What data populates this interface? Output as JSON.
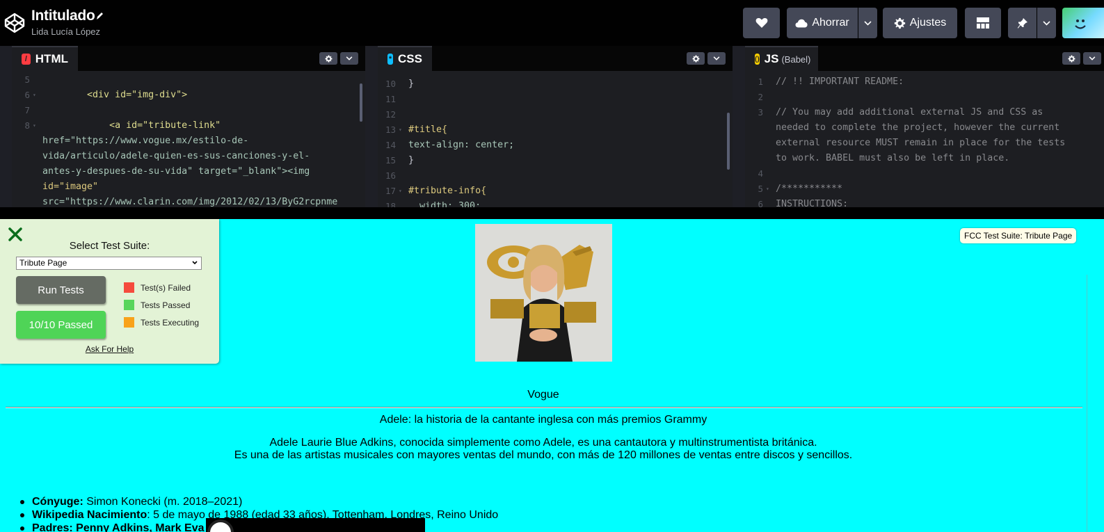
{
  "header": {
    "title": "Intitulado",
    "author": "Lida Lucía López",
    "save_label": "Ahorrar",
    "settings_label": "Ajustes"
  },
  "editors": {
    "html": {
      "label": "HTML",
      "lines": [
        {
          "n": "5",
          "text": ""
        },
        {
          "n": "6",
          "text": "        <div id=\"img-div\">"
        },
        {
          "n": "7",
          "text": ""
        },
        {
          "n": "8",
          "text": "            <a id=\"tribute-link\""
        },
        {
          "n": "",
          "text": "href=\"https://www.vogue.mx/estilo-de-"
        },
        {
          "n": "",
          "text": "vida/articulo/adele-quien-es-sus-canciones-y-el-"
        },
        {
          "n": "",
          "text": "antes-y-despues-de-su-vida\" target=\"_blank\"><img"
        },
        {
          "n": "",
          "text": "id=\"image\""
        },
        {
          "n": "",
          "text": "src=\"https://www.clarin.com/img/2012/02/13/ByG2rcpnme"
        }
      ]
    },
    "css": {
      "label": "CSS",
      "lines": [
        {
          "n": "10",
          "text": "}"
        },
        {
          "n": "11",
          "text": ""
        },
        {
          "n": "12",
          "text": ""
        },
        {
          "n": "13",
          "text": "#title{"
        },
        {
          "n": "14",
          "text": "text-align: center;"
        },
        {
          "n": "15",
          "text": "}"
        },
        {
          "n": "16",
          "text": ""
        },
        {
          "n": "17",
          "text": "#tribute-info{"
        },
        {
          "n": "18",
          "text": "  width: 300;"
        }
      ]
    },
    "js": {
      "label": "JS",
      "sublabel": "(Babel)",
      "lines": [
        {
          "n": "1",
          "text": "// !! IMPORTANT README:"
        },
        {
          "n": "2",
          "text": ""
        },
        {
          "n": "3",
          "text": "// You may add additional external JS and CSS as"
        },
        {
          "n": "",
          "text": "needed to complete the project, however the current"
        },
        {
          "n": "",
          "text": "external resource MUST remain in place for the tests"
        },
        {
          "n": "",
          "text": "to work. BABEL must also be left in place."
        },
        {
          "n": "4",
          "text": ""
        },
        {
          "n": "5",
          "text": "/***********"
        },
        {
          "n": "6",
          "text": "INSTRUCTIONS:"
        }
      ]
    }
  },
  "preview": {
    "source": "Vogue",
    "headline": "Adele: la historia de la cantante inglesa con más premios Grammy",
    "info_line1": "Adele Laurie Blue Adkins, conocida simplemente como Adele, es una cantautora y multinstrumentista británica.",
    "info_line2": "Es una de las artistas musicales con mayores ventas del mundo, con más de 120 millones de ventas entre discos y sencillos.",
    "facts": [
      {
        "label": "Cónyuge:",
        "value": " Simon Konecki (m. 2018–2021)"
      },
      {
        "label": "Wikipedia Nacimiento",
        "value": ": 5 de mayo de 1988 (edad 33 años), Tottenham, Londres, Reino Unido"
      },
      {
        "label": "Padres: Penny Adkins, Mark Eva",
        "value": ""
      }
    ]
  },
  "fcc": {
    "select_label": "Select Test Suite:",
    "selected_suite": "Tribute Page",
    "run_label": "Run Tests",
    "passed_label": "10/10 Passed",
    "legend": [
      "Test(s) Failed",
      "Tests Passed",
      "Tests Executing"
    ],
    "legend_colors": [
      "#f54b3d",
      "#59d55b",
      "#f8a21a"
    ],
    "help_label": "Ask For Help",
    "badge": "FCC Test Suite: Tribute Page"
  }
}
